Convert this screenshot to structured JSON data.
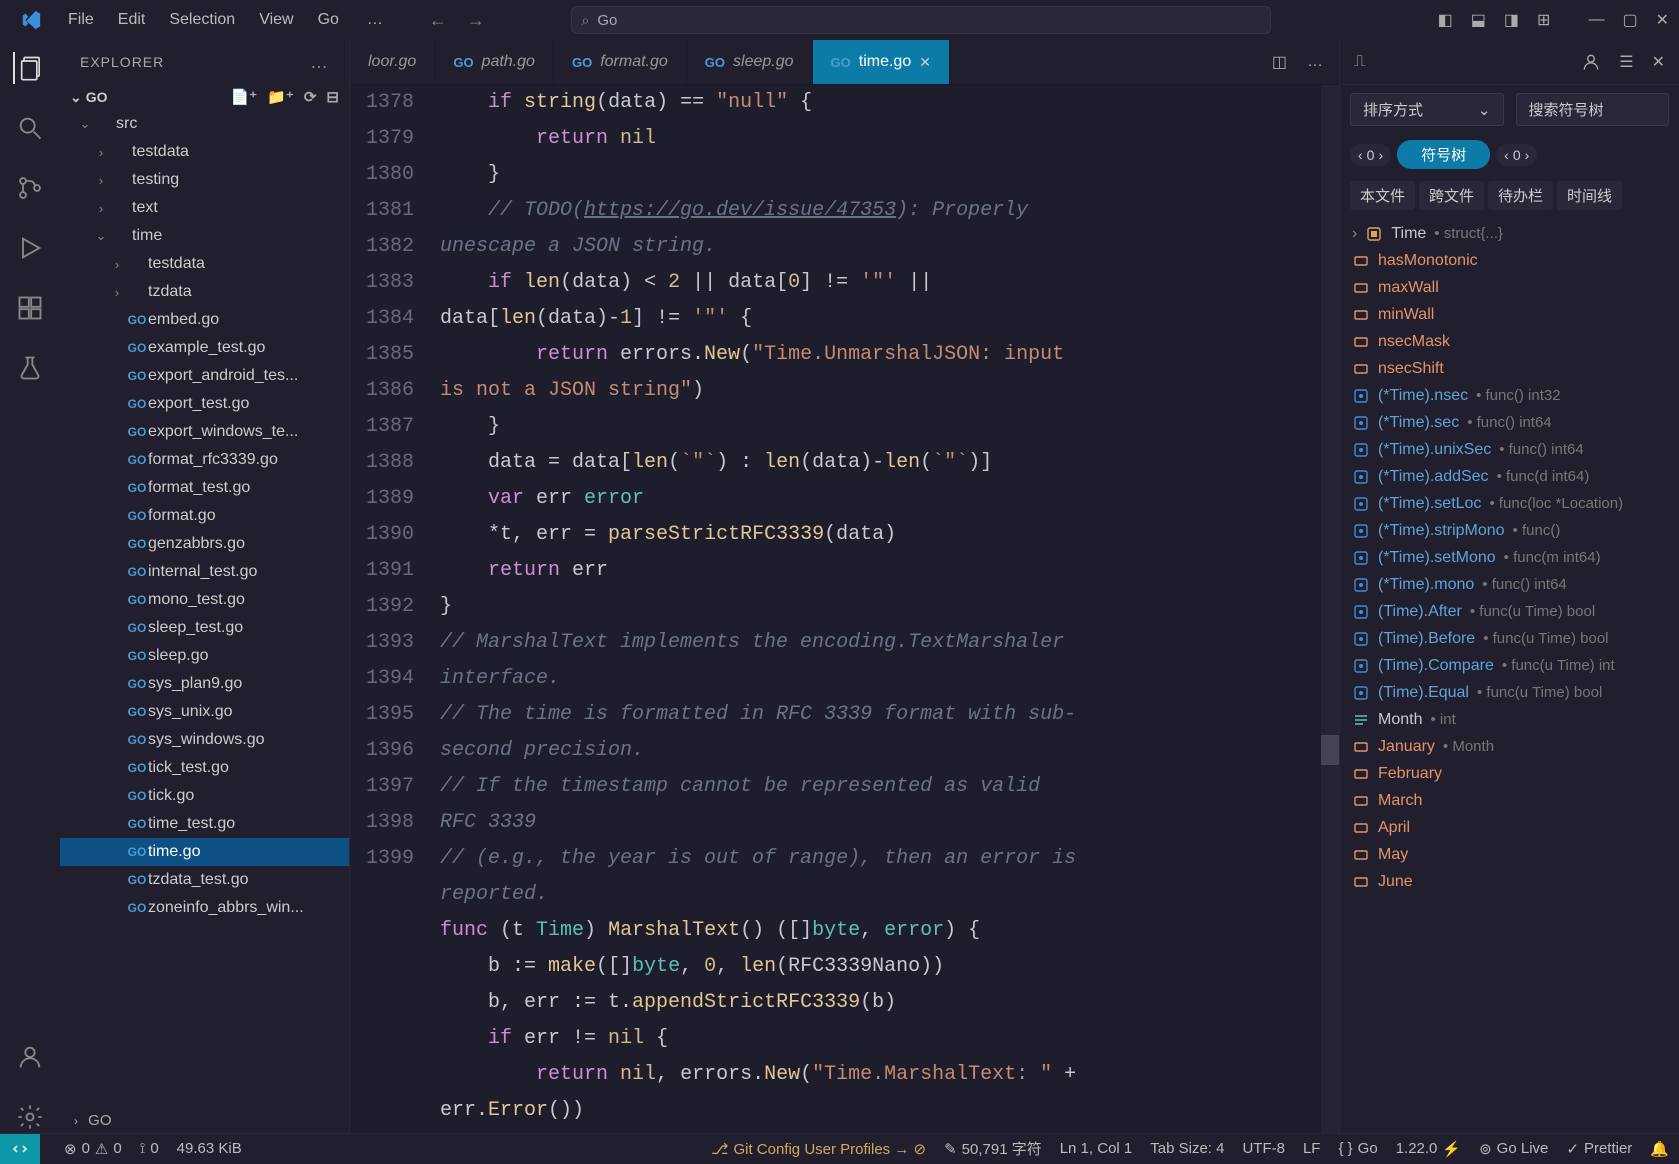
{
  "titlebar": {
    "menus": [
      "File",
      "Edit",
      "Selection",
      "View",
      "Go"
    ],
    "search_text": "Go"
  },
  "activitybar": {
    "items": [
      "files-icon",
      "search-icon",
      "branch-icon",
      "debug-icon",
      "extensions-icon",
      "beaker-icon"
    ],
    "bottom": [
      "account-icon",
      "gear-icon"
    ]
  },
  "sidebar": {
    "title": "EXPLORER",
    "folder_title": "GO",
    "tree": [
      {
        "type": "folder",
        "label": "src",
        "indent": 1,
        "expanded": true
      },
      {
        "type": "folder",
        "label": "testdata",
        "indent": 2,
        "expanded": false
      },
      {
        "type": "folder",
        "label": "testing",
        "indent": 2,
        "expanded": false
      },
      {
        "type": "folder",
        "label": "text",
        "indent": 2,
        "expanded": false
      },
      {
        "type": "folder",
        "label": "time",
        "indent": 2,
        "expanded": true
      },
      {
        "type": "folder",
        "label": "testdata",
        "indent": 3,
        "expanded": false
      },
      {
        "type": "folder",
        "label": "tzdata",
        "indent": 3,
        "expanded": false
      },
      {
        "type": "file",
        "label": "embed.go",
        "indent": 3
      },
      {
        "type": "file",
        "label": "example_test.go",
        "indent": 3
      },
      {
        "type": "file",
        "label": "export_android_tes...",
        "indent": 3
      },
      {
        "type": "file",
        "label": "export_test.go",
        "indent": 3
      },
      {
        "type": "file",
        "label": "export_windows_te...",
        "indent": 3
      },
      {
        "type": "file",
        "label": "format_rfc3339.go",
        "indent": 3
      },
      {
        "type": "file",
        "label": "format_test.go",
        "indent": 3
      },
      {
        "type": "file",
        "label": "format.go",
        "indent": 3
      },
      {
        "type": "file",
        "label": "genzabbrs.go",
        "indent": 3
      },
      {
        "type": "file",
        "label": "internal_test.go",
        "indent": 3
      },
      {
        "type": "file",
        "label": "mono_test.go",
        "indent": 3
      },
      {
        "type": "file",
        "label": "sleep_test.go",
        "indent": 3
      },
      {
        "type": "file",
        "label": "sleep.go",
        "indent": 3
      },
      {
        "type": "file",
        "label": "sys_plan9.go",
        "indent": 3
      },
      {
        "type": "file",
        "label": "sys_unix.go",
        "indent": 3
      },
      {
        "type": "file",
        "label": "sys_windows.go",
        "indent": 3
      },
      {
        "type": "file",
        "label": "tick_test.go",
        "indent": 3
      },
      {
        "type": "file",
        "label": "tick.go",
        "indent": 3
      },
      {
        "type": "file",
        "label": "time_test.go",
        "indent": 3
      },
      {
        "type": "file",
        "label": "time.go",
        "indent": 3,
        "selected": true
      },
      {
        "type": "file",
        "label": "tzdata_test.go",
        "indent": 3
      },
      {
        "type": "file",
        "label": "zoneinfo_abbrs_win...",
        "indent": 3
      }
    ],
    "bottom_label": "GO"
  },
  "tabs": {
    "items": [
      {
        "label": "loor.go",
        "active": false,
        "icon": false
      },
      {
        "label": "path.go",
        "active": false,
        "icon": true
      },
      {
        "label": "format.go",
        "active": false,
        "icon": true
      },
      {
        "label": "sleep.go",
        "active": false,
        "icon": true
      },
      {
        "label": "time.go",
        "active": true,
        "icon": true
      }
    ]
  },
  "code": {
    "lines": [
      {
        "n": 1378,
        "html": "    <span class='k-keyword'>if</span> <span class='k-func'>string</span>(data) == <span class='k-string'>\"null\"</span> {"
      },
      {
        "n": 1379,
        "html": "        <span class='k-keyword'>return</span> <span class='k-const'>nil</span>"
      },
      {
        "n": 1380,
        "html": "    }"
      },
      {
        "n": 1381,
        "html": "    <span class='k-comment'>// TODO(<span class='k-link'>https://go.dev/issue/47353</span>): Properly unescape a JSON string.</span>"
      },
      {
        "n": 1382,
        "html": "    <span class='k-keyword'>if</span> <span class='k-func'>len</span>(data) < <span class='k-num'>2</span> || data[<span class='k-num'>0</span>] != <span class='k-string'>'\"'</span> || data[<span class='k-func'>len</span>(data)-<span class='k-num'>1</span>] != <span class='k-string'>'\"'</span> {"
      },
      {
        "n": 1383,
        "html": "        <span class='k-keyword'>return</span> errors.<span class='k-func'>New</span>(<span class='k-string'>\"Time.UnmarshalJSON: input is not a JSON string\"</span>)"
      },
      {
        "n": 1384,
        "html": "    }"
      },
      {
        "n": 1385,
        "html": "    data = data[<span class='k-func'>len</span>(<span class='k-string'>`\"`</span>) : <span class='k-func'>len</span>(data)-<span class='k-func'>len</span>(<span class='k-string'>`\"`</span>)]"
      },
      {
        "n": 1386,
        "html": "    <span class='k-keyword'>var</span> err <span class='k-type'>error</span>"
      },
      {
        "n": 1387,
        "html": "    *t, err = <span class='k-func'>parseStrictRFC3339</span>(data)"
      },
      {
        "n": 1388,
        "html": "    <span class='k-keyword'>return</span> err"
      },
      {
        "n": 1389,
        "html": "}"
      },
      {
        "n": 1390,
        "html": ""
      },
      {
        "n": 1391,
        "html": "<span class='k-comment'>// MarshalText implements the encoding.TextMarshaler interface.</span>"
      },
      {
        "n": 1392,
        "html": "<span class='k-comment'>// The time is formatted in RFC 3339 format with sub-second precision.</span>"
      },
      {
        "n": 1393,
        "html": "<span class='k-comment'>// If the timestamp cannot be represented as valid RFC 3339</span>"
      },
      {
        "n": 1394,
        "html": "<span class='k-comment'>// (e.g., the year is out of range), then an error is reported.</span>"
      },
      {
        "n": 1395,
        "html": "<span class='k-keyword'>func</span> (t <span class='k-type'>Time</span>) <span class='k-func'>MarshalText</span>() ([]<span class='k-type'>byte</span>, <span class='k-type'>error</span>) {"
      },
      {
        "n": 1396,
        "html": "    b := <span class='k-func'>make</span>([]<span class='k-type'>byte</span>, <span class='k-num'>0</span>, <span class='k-func'>len</span>(RFC3339Nano))"
      },
      {
        "n": 1397,
        "html": "    b, err := t.<span class='k-func'>appendStrictRFC3339</span>(b)"
      },
      {
        "n": 1398,
        "html": "    <span class='k-keyword'>if</span> err != <span class='k-const'>nil</span> {"
      },
      {
        "n": 1399,
        "html": "        <span class='k-keyword'>return</span> <span class='k-const'>nil</span>, errors.<span class='k-func'>New</span>(<span class='k-string'>\"Time.MarshalText: \"</span> + err.<span class='k-func'>Error</span>())"
      }
    ]
  },
  "outline": {
    "sort_label": "排序方式",
    "search_label": "搜索符号树",
    "pill": "符号树",
    "nav_zero": "0",
    "tabs": [
      "本文件",
      "跨文件",
      "待办栏",
      "时间线"
    ],
    "items": [
      {
        "kind": "struct",
        "name": "Time",
        "sig": "• struct{...}",
        "chev": true,
        "cls": ""
      },
      {
        "kind": "const",
        "name": "hasMonotonic",
        "cls": "orange"
      },
      {
        "kind": "const",
        "name": "maxWall",
        "cls": "orange"
      },
      {
        "kind": "const",
        "name": "minWall",
        "cls": "orange"
      },
      {
        "kind": "const",
        "name": "nsecMask",
        "cls": "orange"
      },
      {
        "kind": "const",
        "name": "nsecShift",
        "cls": "orange"
      },
      {
        "kind": "func",
        "name": "(*Time).nsec",
        "sig": "• func() int32",
        "cls": "blue"
      },
      {
        "kind": "func",
        "name": "(*Time).sec",
        "sig": "• func() int64",
        "cls": "blue"
      },
      {
        "kind": "func",
        "name": "(*Time).unixSec",
        "sig": "• func() int64",
        "cls": "blue"
      },
      {
        "kind": "func",
        "name": "(*Time).addSec",
        "sig": "• func(d int64)",
        "cls": "blue"
      },
      {
        "kind": "func",
        "name": "(*Time).setLoc",
        "sig": "• func(loc *Location)",
        "cls": "blue"
      },
      {
        "kind": "func",
        "name": "(*Time).stripMono",
        "sig": "• func()",
        "cls": "blue"
      },
      {
        "kind": "func",
        "name": "(*Time).setMono",
        "sig": "• func(m int64)",
        "cls": "blue"
      },
      {
        "kind": "func",
        "name": "(*Time).mono",
        "sig": "• func() int64",
        "cls": "blue"
      },
      {
        "kind": "func",
        "name": "(Time).After",
        "sig": "• func(u Time) bool",
        "cls": "blue"
      },
      {
        "kind": "func",
        "name": "(Time).Before",
        "sig": "• func(u Time) bool",
        "cls": "blue"
      },
      {
        "kind": "func",
        "name": "(Time).Compare",
        "sig": "• func(u Time) int",
        "cls": "blue"
      },
      {
        "kind": "func",
        "name": "(Time).Equal",
        "sig": "• func(u Time) bool",
        "cls": "blue"
      },
      {
        "kind": "enum",
        "name": "Month",
        "sig": "• int",
        "cls": ""
      },
      {
        "kind": "emem",
        "name": "January",
        "sig": "• Month",
        "cls": "orange"
      },
      {
        "kind": "emem",
        "name": "February",
        "cls": "orange"
      },
      {
        "kind": "emem",
        "name": "March",
        "cls": "orange"
      },
      {
        "kind": "emem",
        "name": "April",
        "cls": "orange"
      },
      {
        "kind": "emem",
        "name": "May",
        "cls": "orange"
      },
      {
        "kind": "emem",
        "name": "June",
        "cls": "orange"
      }
    ]
  },
  "status": {
    "errors": "0",
    "warnings": "0",
    "ports": "0",
    "size": "49.63 KiB",
    "git": "Git Config User Profiles → ⊘",
    "chars": "50,791 字符",
    "pos": "Ln 1, Col 1",
    "tab": "Tab Size: 4",
    "enc": "UTF-8",
    "eol": "LF",
    "lang": "Go",
    "ver": "1.22.0",
    "golive": "Go Live",
    "prettier": "Prettier"
  }
}
